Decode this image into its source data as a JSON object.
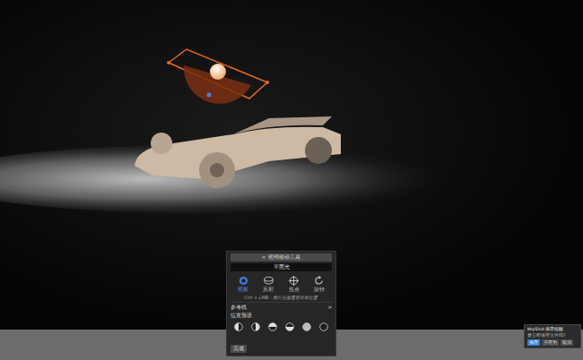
{
  "viewport": {
    "content": "render"
  },
  "light_panel": {
    "back_button": "<",
    "title": "照明移动工具",
    "light_name": "平面光",
    "modes": [
      {
        "label": "照射",
        "kind": "illuminate",
        "selected": true
      },
      {
        "label": "反射",
        "kind": "reflect",
        "selected": false
      },
      {
        "label": "焦点",
        "kind": "target",
        "selected": false
      },
      {
        "label": "旋转",
        "kind": "rotate",
        "selected": false
      }
    ],
    "hint": "Ctrl + LMB：将灯光放置在目标位置",
    "section": {
      "label": "参考线",
      "chevron": ">",
      "expanded": false
    },
    "presets_label": "位置预设",
    "presets": [
      {
        "kind": "left"
      },
      {
        "kind": "right"
      },
      {
        "kind": "top"
      },
      {
        "kind": "bottom"
      },
      {
        "kind": "full"
      },
      {
        "kind": "none"
      }
    ],
    "done_button": "完成"
  },
  "notification": {
    "title": "KeyShot 保存提醒",
    "message": "要立即保存文件吗?",
    "buttons": [
      {
        "label": "保存",
        "primary": true
      },
      {
        "label": "另存为",
        "primary": false
      },
      {
        "label": "取消",
        "primary": false
      }
    ]
  }
}
